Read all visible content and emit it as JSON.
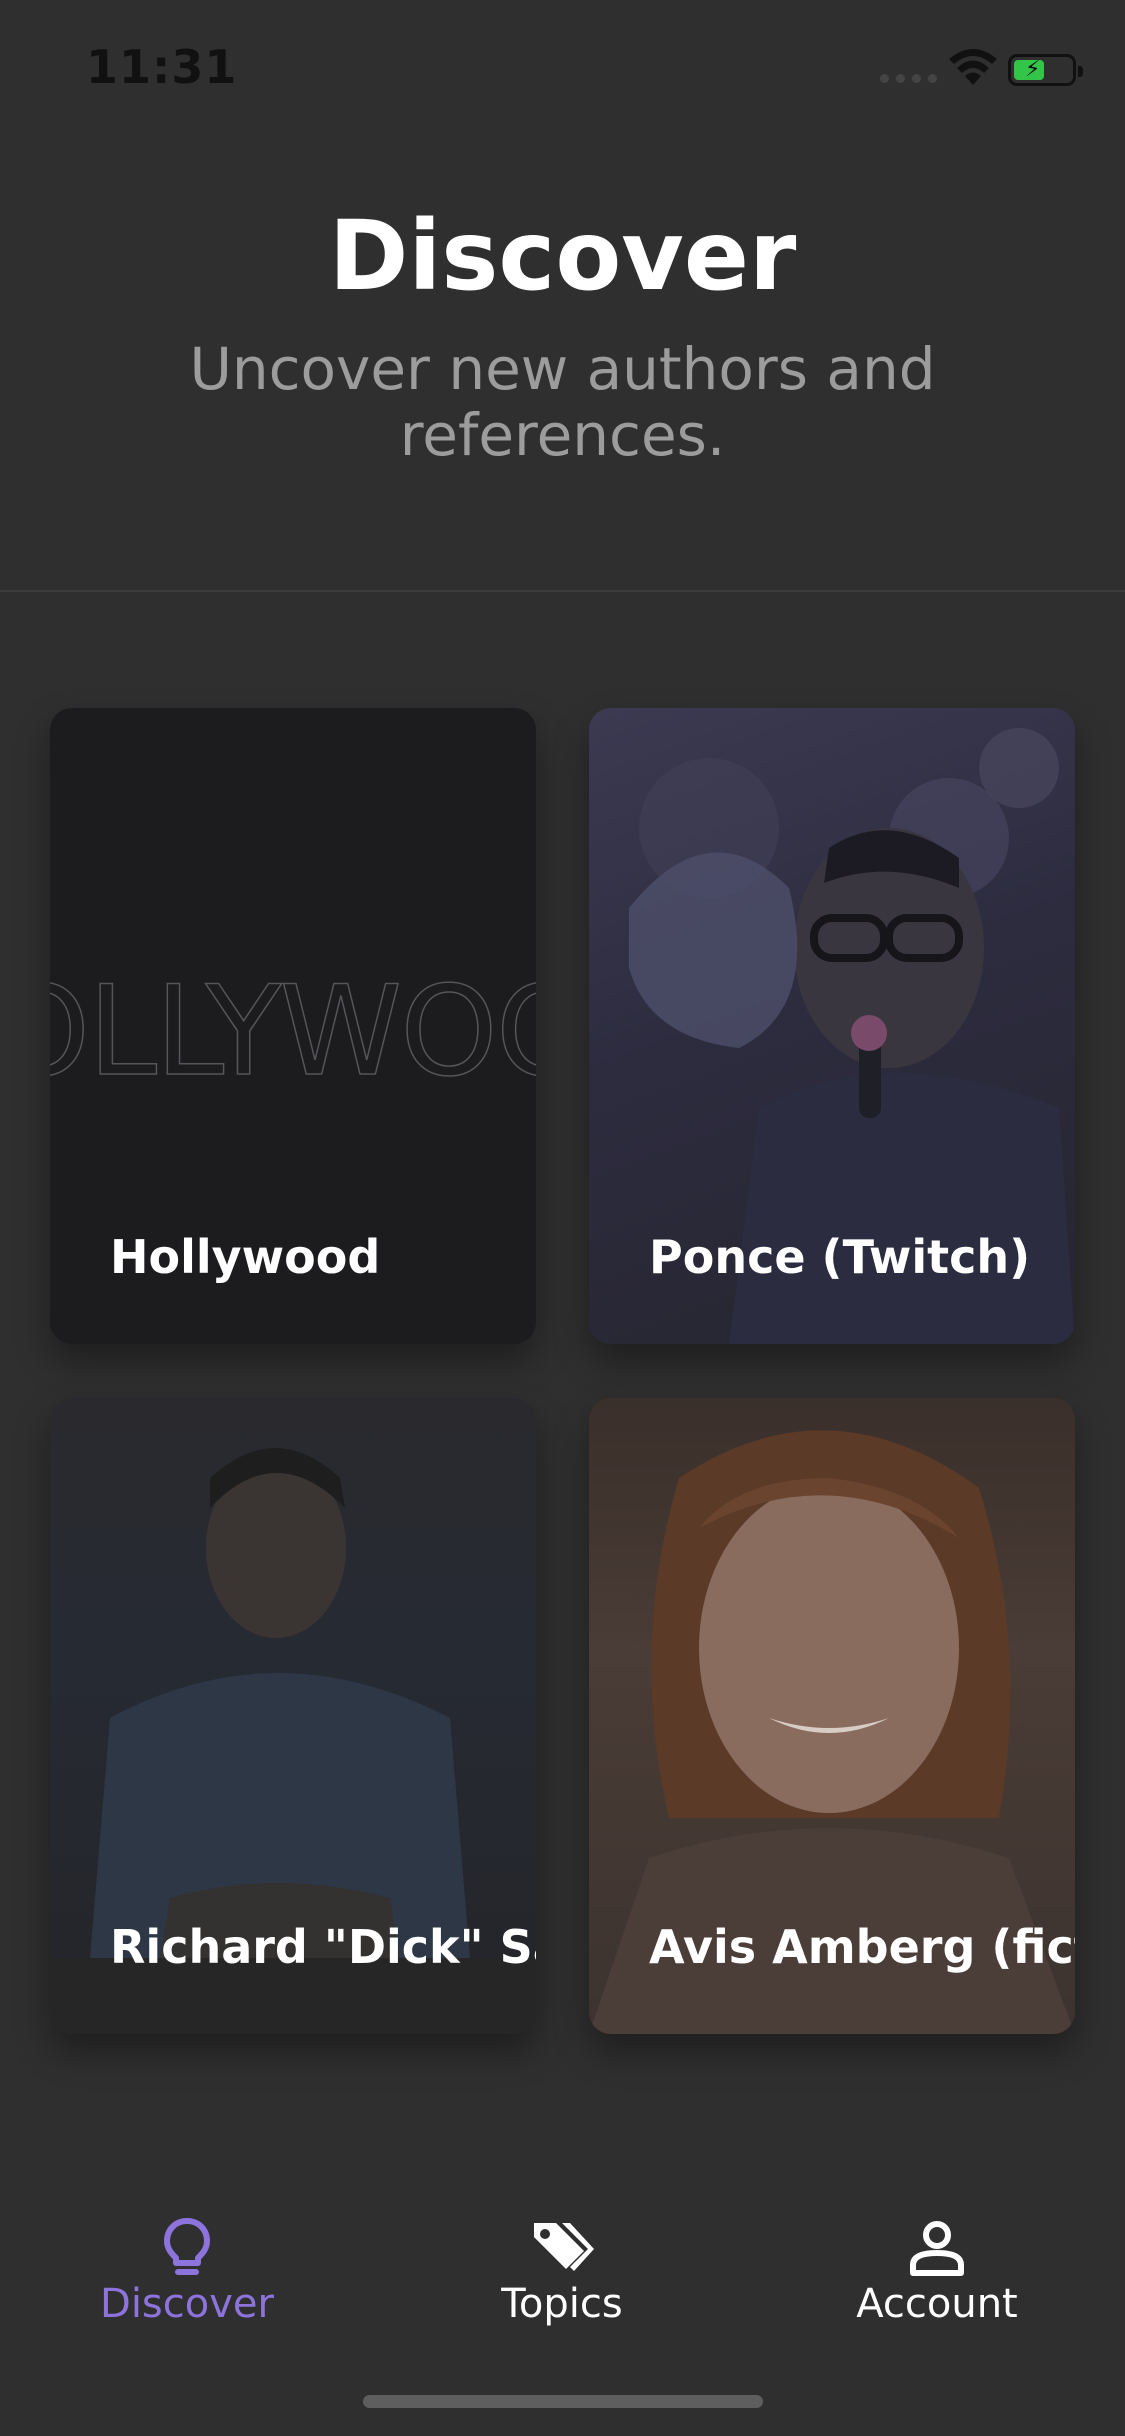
{
  "status_bar": {
    "time": "11:31"
  },
  "header": {
    "title": "Discover",
    "subtitle": "Uncover new authors and references."
  },
  "cards": [
    {
      "label": "Hollywood",
      "art_text": "HOLLYWOOD"
    },
    {
      "label": "Ponce (Twitch)"
    },
    {
      "label": "Richard \"Dick\" Samuels"
    },
    {
      "label": "Avis Amberg (fictional character)"
    }
  ],
  "tab_bar": {
    "items": [
      {
        "label": "Discover",
        "icon": "lightbulb-icon",
        "active": true
      },
      {
        "label": "Topics",
        "icon": "tags-icon",
        "active": false
      },
      {
        "label": "Account",
        "icon": "user-icon",
        "active": false
      }
    ]
  },
  "colors": {
    "background": "#2f2f2f",
    "accent": "#8d74dc",
    "subtitle": "#9c9c9c"
  }
}
